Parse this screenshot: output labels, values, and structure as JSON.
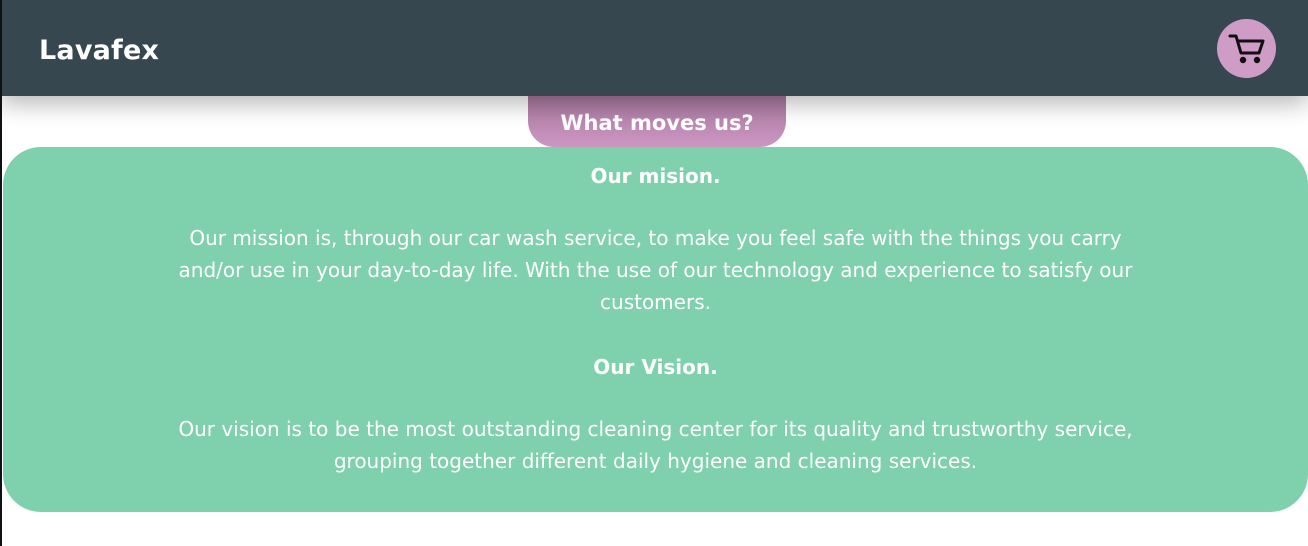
{
  "header": {
    "brand": "Lavafex",
    "cart_icon": "shopping-cart-icon",
    "background_color": "#37474f",
    "cart_button_color": "#cf9bc7"
  },
  "tab": {
    "label": "What moves us?",
    "color": "#c592be"
  },
  "content": {
    "mission_title": "Our mision.",
    "mission_text": "Our mission is, through our car wash service, to make you feel safe with the things you carry and/or use in your day-to-day life. With the use of our technology and experience to satisfy our customers.",
    "vision_title": "Our Vision.",
    "vision_text": "Our vision is to be the most outstanding cleaning center for its quality and trustworthy service, grouping together different daily hygiene and cleaning services.",
    "panel_color": "#7fd0ac"
  }
}
